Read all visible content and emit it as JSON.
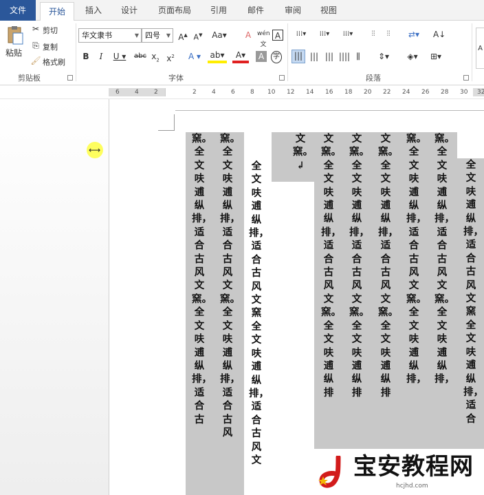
{
  "tabs": [
    "文件",
    "开始",
    "插入",
    "设计",
    "页面布局",
    "引用",
    "邮件",
    "审阅",
    "视图"
  ],
  "clipboard": {
    "paste": "粘贴",
    "cut": "剪切",
    "copy": "复制",
    "format_painter": "格式刷",
    "label": "剪贴板"
  },
  "font": {
    "name": "华文隶书",
    "size": "四号",
    "label": "字体"
  },
  "paragraph": {
    "label": "段落"
  },
  "ruler": {
    "left": [
      "6",
      "4",
      "2"
    ],
    "right": [
      "2",
      "4",
      "6",
      "8",
      "10",
      "12",
      "14",
      "16",
      "18",
      "20",
      "22",
      "24",
      "26",
      "28",
      "30",
      "32"
    ]
  },
  "document": {
    "columns": [
      "窯。全文呋逋纵排，适合古风文窯。全文呋逋纵排，适合古",
      "窯。全文呋逋纵排，适合古风文窯。全文呋逋纵排，适合古风",
      "全文呋逋纵排，适合古风文窯全文呋逋纵排，适合古风文",
      "文窯。↲",
      "文窯。全文呋逋纵排，适合古风文窯。全文呋逋纵排",
      "文窯。全文呋逋纵排，适合古风文窯。全文呋逋纵排",
      "文窯。全文呋逋纵排，适合古风文窯。全文呋逋纵排",
      "窯。全文呋逋纵排，适合古风文窯。全文呋逋纵排，",
      "窯。全文呋逋纵排，适合古风文窯。全文呋逋纵排，",
      "全文呋逋纵排，适合古风文窯全文呋逋纵排，适合"
    ]
  },
  "watermark": {
    "text": "宝安教程网",
    "url": "hcjhd.com"
  }
}
